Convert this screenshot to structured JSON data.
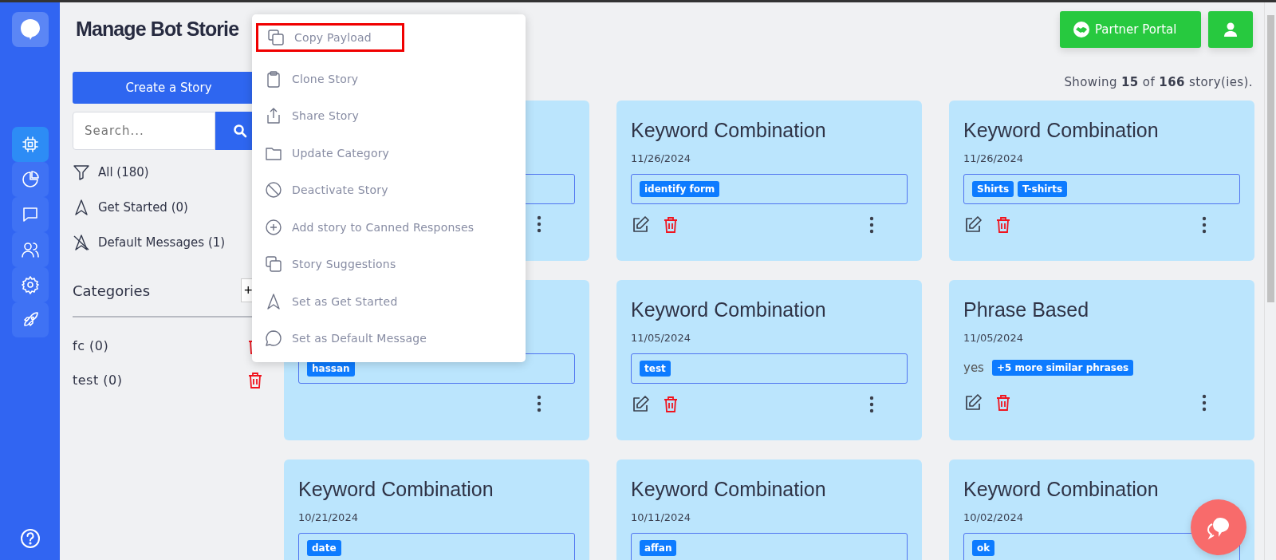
{
  "sidebar": {
    "nav": [
      {
        "selected": true
      },
      {
        "selected": false
      },
      {
        "selected": false
      },
      {
        "selected": false
      },
      {
        "selected": false
      },
      {
        "selected": false
      }
    ]
  },
  "header": {
    "title": "Manage Bot Storie",
    "partner_button": "Partner Portal"
  },
  "left_panel": {
    "create_button": "Create a Story",
    "search": {
      "placeholder": "Search..."
    },
    "filters": [
      {
        "label": "All (180)"
      },
      {
        "label": "Get Started (0)"
      },
      {
        "label": "Default Messages (1)"
      }
    ],
    "categories_title": "Categories",
    "add_category": "+",
    "categories": [
      {
        "label": "fc (0)"
      },
      {
        "label": "test (0)"
      }
    ]
  },
  "summary": {
    "prefix": "Showing ",
    "shown": "15",
    "middle": " of ",
    "total": "166",
    "suffix": " story(ies)."
  },
  "cards": [
    {
      "kind": "keywords"
    },
    {
      "kind": "keywords",
      "title": "Keyword Combination",
      "date": "11/26/2024",
      "tags": [
        "identify form"
      ]
    },
    {
      "kind": "keywords",
      "title": "Keyword Combination",
      "date": "11/26/2024",
      "tags": [
        "Shirts",
        "T-shirts"
      ]
    },
    {
      "kind": "keywords",
      "tags": [
        "hassan"
      ]
    },
    {
      "kind": "keywords",
      "title": "Keyword Combination",
      "date": "11/05/2024",
      "tags": [
        "test"
      ]
    },
    {
      "kind": "phrase",
      "title": "Phrase Based",
      "date": "11/05/2024",
      "phrase": "yes",
      "tags": [
        "+5 more similar phrases"
      ]
    },
    {
      "kind": "keywords",
      "title": "Keyword Combination",
      "date": "10/21/2024",
      "tags": [
        "date"
      ]
    },
    {
      "kind": "keywords",
      "title": "Keyword Combination",
      "date": "10/11/2024",
      "tags": [
        "affan"
      ]
    },
    {
      "kind": "keywords",
      "title": "Keyword Combination",
      "date": "10/02/2024",
      "tags": [
        "ok"
      ]
    }
  ],
  "context_menu": [
    {
      "label": "Copy Payload",
      "highlighted": true
    },
    {
      "label": "Clone Story",
      "highlighted": false
    },
    {
      "label": "Share Story",
      "highlighted": false
    },
    {
      "label": "Update Category",
      "highlighted": false
    },
    {
      "label": "Deactivate Story",
      "highlighted": false
    },
    {
      "label": "Add story to Canned Responses",
      "highlighted": false
    },
    {
      "label": "Story Suggestions",
      "highlighted": false
    },
    {
      "label": "Set as Get Started",
      "highlighted": false
    },
    {
      "label": "Set as Default Message",
      "highlighted": false
    }
  ]
}
